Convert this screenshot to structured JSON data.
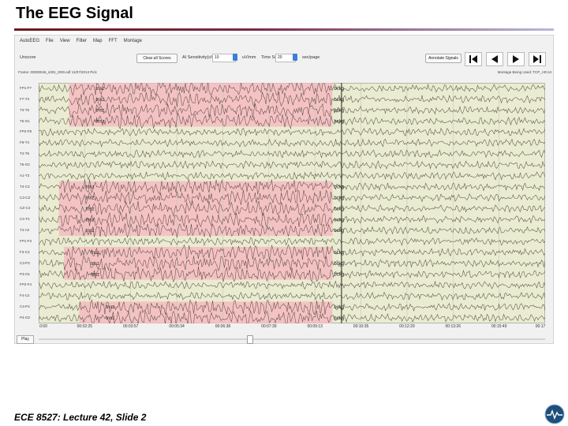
{
  "slide": {
    "title": "The EEG Signal",
    "footer": "ECE 8527: Lecture 42, Slide 2"
  },
  "app": {
    "menu": [
      "AutoEEG",
      "File",
      "View",
      "Filter",
      "Map",
      "FFT",
      "Montage"
    ],
    "toolbar": {
      "left_label": "Unscore",
      "button_1": "Clear all Scores",
      "sensitivity_label": "AI Sensitivity(uV/mm)",
      "sensitivity_value": "10",
      "time_scale_label": "Time Scale",
      "time_scale_value": "20",
      "time_unit": "sec/page",
      "annotation_button": "Annotate Signals"
    },
    "status": {
      "left": "Frame: 00000046_s001_t000.edf 11/07/2013 Pick",
      "right": "Montage Being Used: TCP_AR.txt"
    },
    "play_label": "Play"
  },
  "eeg": {
    "channels": [
      "FP1-F7",
      "F7-T3",
      "T3-T5",
      "T5-O1",
      "FP2-F8",
      "F8-T4",
      "T4-T6",
      "T6-O2",
      "A1-T3",
      "T3-C3",
      "C3-CZ",
      "CZ-C4",
      "C4-T4",
      "T4-A2",
      "FP1-F3",
      "F3-C3",
      "C3-P3",
      "P3-O1",
      "FP2-F4",
      "F4-C4",
      "C4-P4",
      "P4-O2"
    ],
    "time_ticks": [
      "0:00",
      "00:02:25",
      "00:03:57",
      "00:05:34",
      "00:06:38",
      "00:07:39",
      "00:09:13",
      "00:10:35",
      "00:12:29",
      "00:13:26",
      "00:15:49",
      "00:17"
    ],
    "highlights": [
      {
        "rows": [
          0,
          1,
          2,
          3
        ],
        "from": 0.06,
        "to": 0.58,
        "start_label": "tnsz",
        "end_label": "bckg"
      },
      {
        "rows": [
          9,
          10,
          11,
          12,
          13
        ],
        "from": 0.04,
        "to": 0.58,
        "start_label": "tnsz",
        "end_label": "bckg"
      },
      {
        "rows": [
          15,
          16,
          17
        ],
        "from": 0.05,
        "to": 0.58,
        "start_label": "tnsz",
        "end_label": "bckg"
      },
      {
        "rows": [
          20,
          21
        ],
        "from": 0.08,
        "to": 0.58,
        "start_label": "tnsz",
        "end_label": "bckg"
      }
    ],
    "colors": {
      "background": "#e9ecd0",
      "highlight": "#f7b8bf",
      "trace": "#5a4f48",
      "marker": "#222222"
    }
  }
}
